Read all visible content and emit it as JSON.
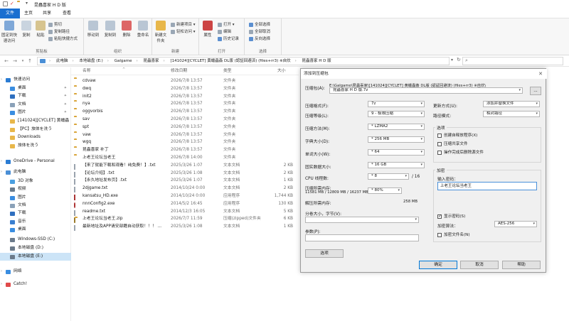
{
  "window": {
    "title": "昆蟲喜家 H D 版",
    "tabs": [
      "文件",
      "主页",
      "共享",
      "查看"
    ],
    "active_tab": "文件"
  },
  "ribbon": {
    "groups": [
      {
        "label": "剪贴板",
        "buttons": [
          "固定到快速访问",
          "复制",
          "粘贴"
        ],
        "small": [
          "剪切",
          "复制路径",
          "粘贴快捷方式"
        ]
      },
      {
        "label": "组织",
        "buttons": [
          "移动到",
          "复制到",
          "删除",
          "重命名"
        ]
      },
      {
        "label": "新建",
        "buttons": [
          "新建文件夹"
        ],
        "small": [
          "新建项目 ▾",
          "轻松访问 ▾"
        ]
      },
      {
        "label": "打开",
        "buttons": [
          "属性"
        ],
        "small": [
          "打开 ▾",
          "编辑",
          "历史记录"
        ]
      },
      {
        "label": "选择",
        "small": [
          "全部选择",
          "全部取消",
          "反向选择"
        ]
      }
    ]
  },
  "address": {
    "crumbs": [
      "此电脑",
      "本地磁盘 (E:)",
      "Galgame",
      "昆蟲喜家",
      "[141024][CYCLET] 黄蠟蟲姦 DL版 (認証回避済) (files+rr3) ※自炊",
      "昆蟲喜家 H D 版"
    ]
  },
  "sidebar": {
    "items": [
      {
        "label": "快速访问",
        "indent": 0,
        "icon": "star-icon",
        "color": "#2b7cd3"
      },
      {
        "label": "桌面",
        "indent": 1,
        "icon": "desktop-icon",
        "color": "#3a8de0",
        "pin": true
      },
      {
        "label": "下载",
        "indent": 1,
        "icon": "download-icon",
        "color": "#2f6fbf",
        "pin": true
      },
      {
        "label": "文档",
        "indent": 1,
        "icon": "document-icon",
        "color": "#8aa1b8",
        "pin": true
      },
      {
        "label": "图片",
        "indent": 1,
        "icon": "picture-icon",
        "color": "#3a8de0",
        "pin": true
      },
      {
        "label": "[141024][CYCLET] 黄蠟蟲",
        "indent": 1,
        "icon": "folder-icon",
        "color": "#e8b74a"
      },
      {
        "label": "【PC】旅体を洗う",
        "indent": 1,
        "icon": "folder-icon",
        "color": "#e8b74a"
      },
      {
        "label": "Downloads",
        "indent": 1,
        "icon": "folder-icon",
        "color": "#e8b74a"
      },
      {
        "label": "旅体を洗う",
        "indent": 1,
        "icon": "folder-icon",
        "color": "#e8b74a"
      },
      {
        "label": "OneDrive - Personal",
        "indent": 0,
        "icon": "cloud-icon",
        "color": "#2b7cd3"
      },
      {
        "label": "此电脑",
        "indent": 0,
        "icon": "computer-icon",
        "color": "#4a8fd6"
      },
      {
        "label": "3D 对象",
        "indent": 1,
        "icon": "cube-icon",
        "color": "#4a9fe0"
      },
      {
        "label": "视频",
        "indent": 1,
        "icon": "video-icon",
        "color": "#6a7b8c"
      },
      {
        "label": "图片",
        "indent": 1,
        "icon": "picture-icon",
        "color": "#3a8de0"
      },
      {
        "label": "文档",
        "indent": 1,
        "icon": "document-icon",
        "color": "#8aa1b8"
      },
      {
        "label": "下载",
        "indent": 1,
        "icon": "download-icon",
        "color": "#2f6fbf"
      },
      {
        "label": "音乐",
        "indent": 1,
        "icon": "music-icon",
        "color": "#3a7fd0"
      },
      {
        "label": "桌面",
        "indent": 1,
        "icon": "desktop-icon",
        "color": "#3a8de0"
      },
      {
        "label": "Windows-SSD (C:)",
        "indent": 1,
        "icon": "drive-icon",
        "color": "#6b7a8a"
      },
      {
        "label": "本地磁盘 (D:)",
        "indent": 1,
        "icon": "drive-icon",
        "color": "#6b7a8a"
      },
      {
        "label": "本地磁盘 (E:)",
        "indent": 1,
        "icon": "drive-icon",
        "color": "#6b7a8a",
        "selected": true
      },
      {
        "label": "网络",
        "indent": 0,
        "icon": "network-icon",
        "color": "#3a8de0"
      },
      {
        "label": "Catch!",
        "indent": 0,
        "icon": "catch-icon",
        "color": "#e04a4a"
      }
    ]
  },
  "columns": {
    "name": "名称",
    "date": "修改日期",
    "type": "类型",
    "size": "大小"
  },
  "files": [
    {
      "name": "cdvaw",
      "date": "2026/7/8 13:57",
      "type": "文件夹",
      "size": "",
      "kind": "folder"
    },
    {
      "name": "dwq",
      "date": "2026/7/8 13:57",
      "type": "文件夹",
      "size": "",
      "kind": "folder"
    },
    {
      "name": "init2",
      "date": "2026/7/8 13:57",
      "type": "文件夹",
      "size": "",
      "kind": "folder"
    },
    {
      "name": "nya",
      "date": "2026/7/8 13:57",
      "type": "文件夹",
      "size": "",
      "kind": "folder"
    },
    {
      "name": "oggvorbis",
      "date": "2026/7/8 13:57",
      "type": "文件夹",
      "size": "",
      "kind": "folder"
    },
    {
      "name": "sav",
      "date": "2026/7/8 13:57",
      "type": "文件夹",
      "size": "",
      "kind": "folder"
    },
    {
      "name": "spt",
      "date": "2026/7/8 13:57",
      "type": "文件夹",
      "size": "",
      "kind": "folder"
    },
    {
      "name": "vaw",
      "date": "2026/7/8 13:57",
      "type": "文件夹",
      "size": "",
      "kind": "folder"
    },
    {
      "name": "wgq",
      "date": "2026/7/8 13:57",
      "type": "文件夹",
      "size": "",
      "kind": "folder"
    },
    {
      "name": "昆蟲喜家 补丁",
      "date": "2026/7/8 13:57",
      "type": "文件夹",
      "size": "",
      "kind": "folder"
    },
    {
      "name": "上老王论坛当老王",
      "date": "2026/7/8 14:00",
      "type": "文件夹",
      "size": "",
      "kind": "folder"
    },
    {
      "name": "【来了就能下载和观看！纯免费！】.txt",
      "date": "2025/3/26 1:07",
      "type": "文本文档",
      "size": "2 KB",
      "kind": "txt"
    },
    {
      "name": "【论坛介绍】.txt",
      "date": "2025/3/26 1:08",
      "type": "文本文档",
      "size": "2 KB",
      "kind": "txt"
    },
    {
      "name": "【永久地址发布页】.txt",
      "date": "2025/3/26 1:07",
      "type": "文本文档",
      "size": "1 KB",
      "kind": "txt"
    },
    {
      "name": "2djgame.txt",
      "date": "2014/10/24 0:00",
      "type": "文本文档",
      "size": "2 KB",
      "kind": "txt"
    },
    {
      "name": "kansatsu_HD.exe",
      "date": "2014/10/24 0:00",
      "type": "应用程序",
      "size": "1,744 KB",
      "kind": "exe"
    },
    {
      "name": "nnnConfig2.exe",
      "date": "2014/5/2 16:45",
      "type": "应用程序",
      "size": "130 KB",
      "kind": "exe2"
    },
    {
      "name": "readme.txt",
      "date": "2014/12/3 16:05",
      "type": "文本文档",
      "size": "5 KB",
      "kind": "txt"
    },
    {
      "name": "上老王论坛当老王.zip",
      "date": "2026/7/7 11:59",
      "type": "压缩(zipped)文件夹",
      "size": "6 KB",
      "kind": "zip"
    },
    {
      "name": "最新地址及APP请安部籍自动获取！！！ ...",
      "date": "2025/3/26 1:08",
      "type": "文本文档",
      "size": "1 KB",
      "kind": "txt"
    }
  ],
  "dialog": {
    "title": "添加到压缩包",
    "archive_label": "压缩包(A):",
    "archive_path": "E:\\Galgame\\昆蟲喜家\\[141024][CYCLET] 黄蠟蟲姦 DL版 (認証回避済) (files+rr3) ※自炊\\",
    "archive_name": "昆蟲喜家 H D 版.7z",
    "browse": "...",
    "left_fields": [
      {
        "label": "压缩格式(F):",
        "value": "7z"
      },
      {
        "label": "压缩等级(L):",
        "value": "9 - 极限压缩"
      },
      {
        "label": "压缩方法(M):",
        "value": "* LZMA2"
      },
      {
        "label": "字典大小(D):",
        "value": "* 256 MB"
      },
      {
        "label": "单词大小(W):",
        "value": "* 64"
      },
      {
        "label": "固实数据大小:",
        "value": "* 16 GB"
      },
      {
        "label": "CPU 线程数:",
        "value": "* 8"
      }
    ],
    "cpu_total": "/ 16",
    "mem_label": "压缩所需内存:",
    "mem_value": "11581 MB / 12809 MB / 16237 MB",
    "mem_percent": "* 80%",
    "decomp_label": "解压所需内存:",
    "decomp_value": "258 MB",
    "split_label": "分卷大小，字节(V):",
    "params_label": "参数(P):",
    "options_button": "选项",
    "update_label": "更新方式(U):",
    "update_value": "添加并替换文件",
    "path_label": "路径模式:",
    "path_value": "相对路径",
    "options_title": "选项",
    "options": [
      {
        "label": "创建自释放程序(X)",
        "checked": false
      },
      {
        "label": "压缩共享文件",
        "checked": false
      },
      {
        "label": "操作完成后删除源文件",
        "checked": false
      }
    ],
    "encrypt_title": "加密",
    "password_label": "输入密码：",
    "password_value": "上老王论坛当老王",
    "show_password": "显示密码(S)",
    "show_password_checked": true,
    "method_label": "加密算法：",
    "method_value": "AES-256",
    "encrypt_names": "加密文件名(N)",
    "ok": "确定",
    "cancel": "取消",
    "help": "帮助"
  }
}
